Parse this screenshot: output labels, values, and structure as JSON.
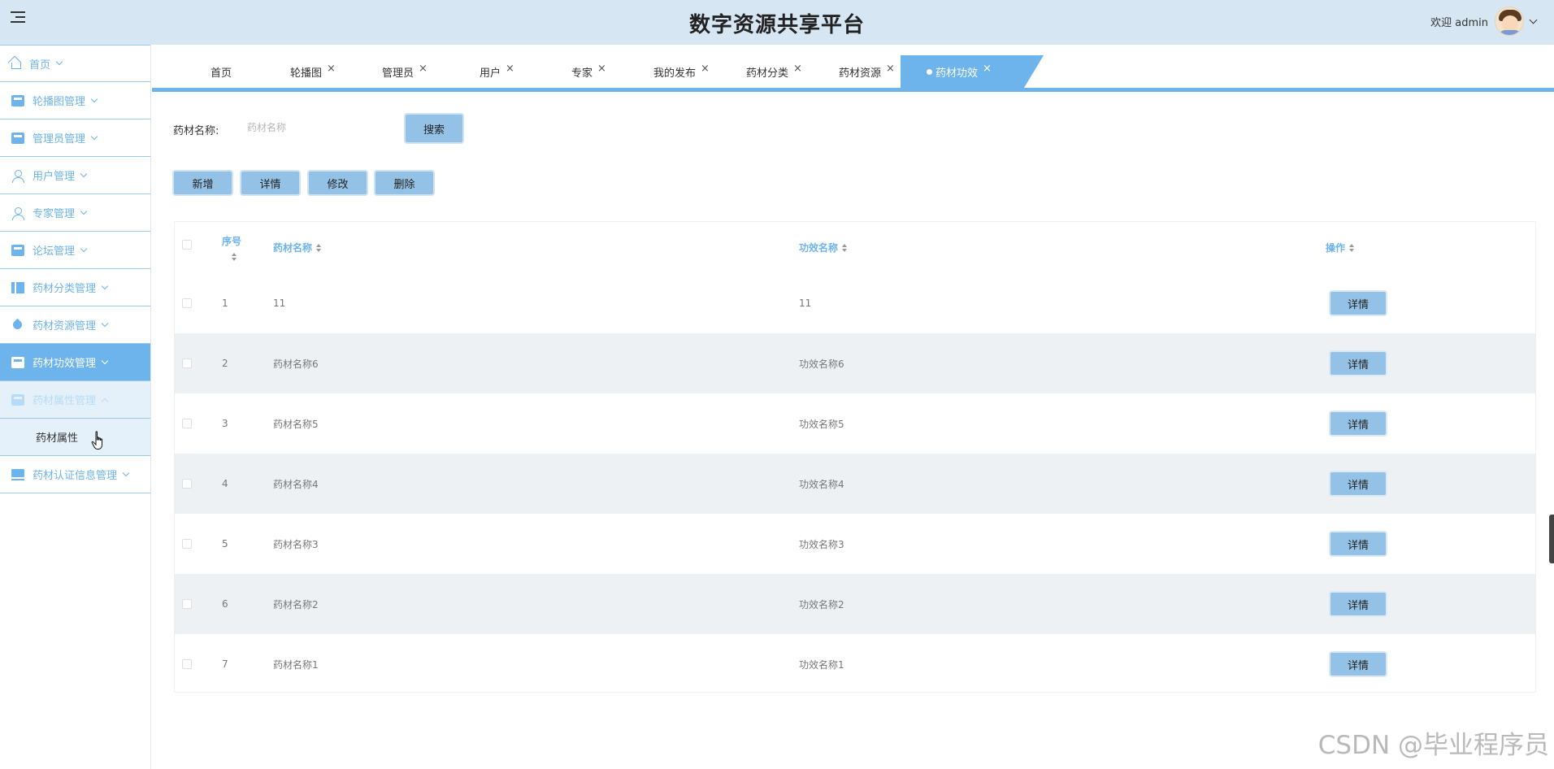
{
  "header": {
    "title": "数字资源共享平台",
    "welcome": "欢迎 admin"
  },
  "sidebar": {
    "items": [
      {
        "label": "首页",
        "icon": "home-icon"
      },
      {
        "label": "轮播图管理",
        "icon": "image-icon"
      },
      {
        "label": "管理员管理",
        "icon": "admin-icon"
      },
      {
        "label": "用户管理",
        "icon": "user-icon"
      },
      {
        "label": "专家管理",
        "icon": "expert-icon"
      },
      {
        "label": "论坛管理",
        "icon": "forum-icon"
      },
      {
        "label": "药材分类管理",
        "icon": "category-icon"
      },
      {
        "label": "药材资源管理",
        "icon": "resource-icon"
      },
      {
        "label": "药材功效管理",
        "icon": "efficacy-icon"
      },
      {
        "label": "药材属性管理",
        "icon": "attribute-icon"
      },
      {
        "label": "药材认证信息管理",
        "icon": "certification-icon"
      }
    ],
    "sub_item": "药材属性"
  },
  "tabs": [
    {
      "label": "首页"
    },
    {
      "label": "轮播图"
    },
    {
      "label": "管理员"
    },
    {
      "label": "用户"
    },
    {
      "label": "专家"
    },
    {
      "label": "我的发布"
    },
    {
      "label": "药材分类"
    },
    {
      "label": "药材资源"
    },
    {
      "label": "药材功效"
    }
  ],
  "search": {
    "label": "药材名称:",
    "placeholder": "药材名称",
    "button": "搜索"
  },
  "actions": {
    "add": "新增",
    "detail": "详情",
    "edit": "修改",
    "delete": "删除"
  },
  "table": {
    "columns": [
      "序号",
      "药材名称",
      "功效名称",
      "操作"
    ],
    "rows": [
      {
        "index": "1",
        "name": "11",
        "efficacy": "11",
        "action": "详情"
      },
      {
        "index": "2",
        "name": "药材名称6",
        "efficacy": "功效名称6",
        "action": "详情"
      },
      {
        "index": "3",
        "name": "药材名称5",
        "efficacy": "功效名称5",
        "action": "详情"
      },
      {
        "index": "4",
        "name": "药材名称4",
        "efficacy": "功效名称4",
        "action": "详情"
      },
      {
        "index": "5",
        "name": "药材名称3",
        "efficacy": "功效名称3",
        "action": "详情"
      },
      {
        "index": "6",
        "name": "药材名称2",
        "efficacy": "功效名称2",
        "action": "详情"
      },
      {
        "index": "7",
        "name": "药材名称1",
        "efficacy": "功效名称1",
        "action": "详情"
      }
    ]
  },
  "watermark": "CSDN @毕业程序员",
  "colors": {
    "header_bg": "#d6e6f3",
    "accent": "#6db3ec",
    "button": "#93c2e6",
    "row_alt": "#edf1f3"
  }
}
